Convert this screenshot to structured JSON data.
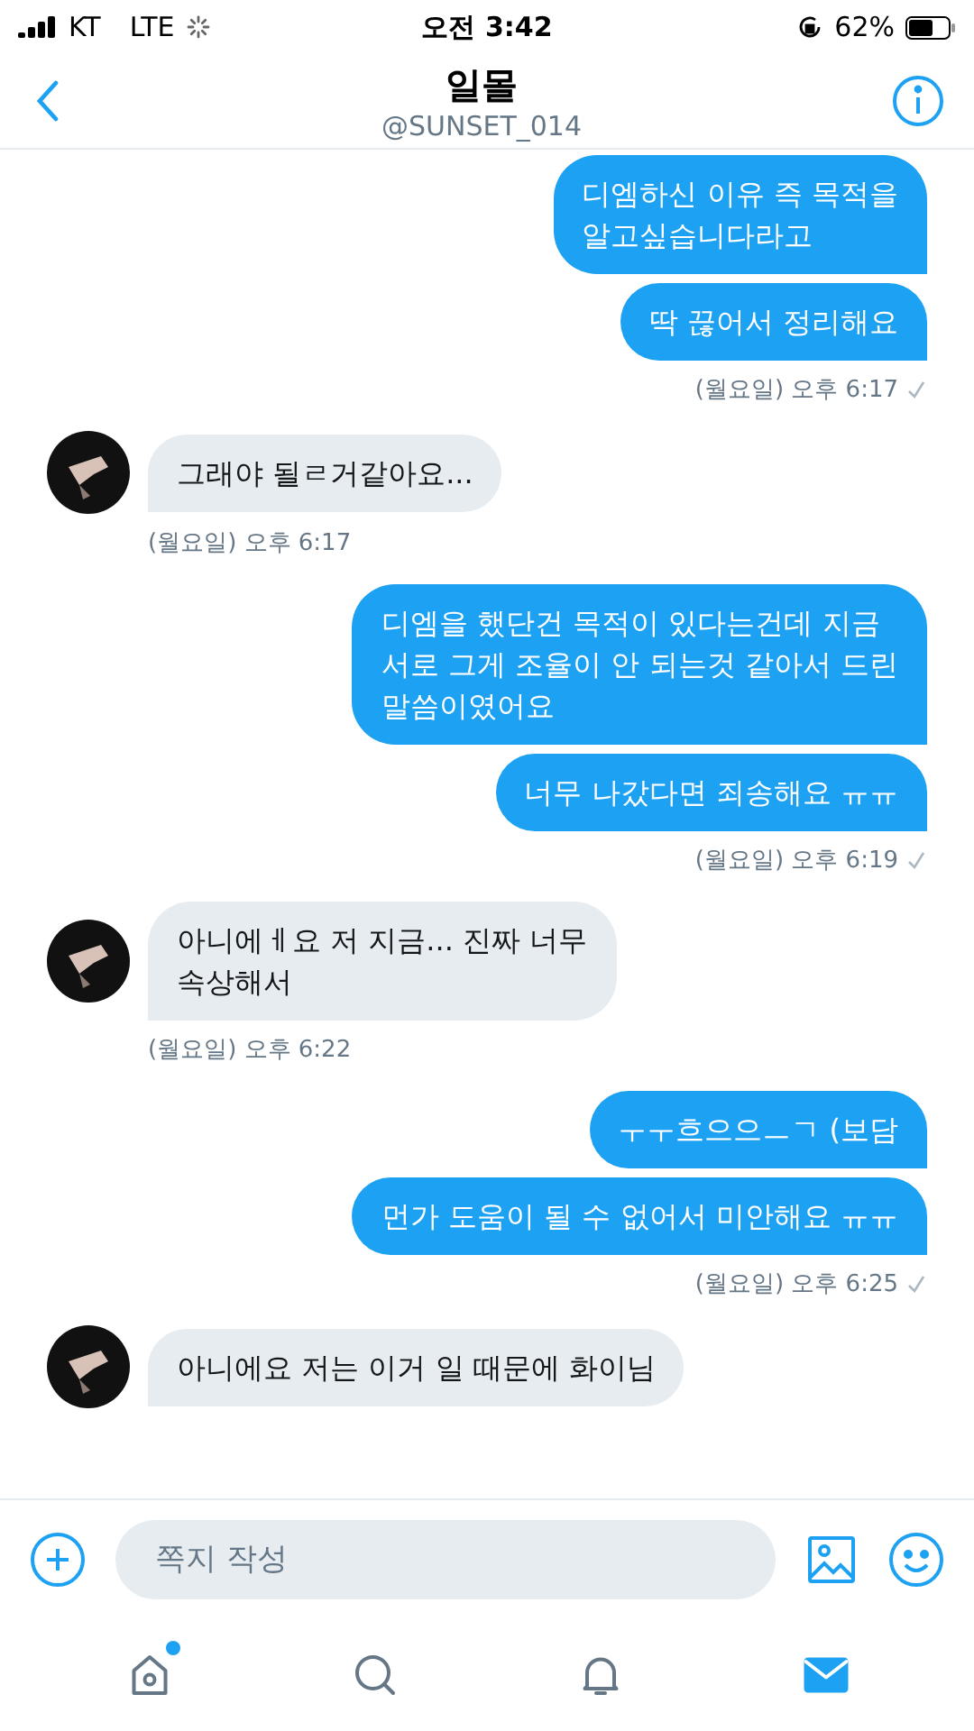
{
  "status_bar": {
    "carrier": "KT",
    "network": "LTE",
    "time": "오전 3:42",
    "battery": "62%"
  },
  "header": {
    "title": "일몰",
    "handle": "@SUNSET_014"
  },
  "groups": [
    {
      "kind": "sent",
      "messages": [
        "디엠하신 이유 즉 목적을\n알고싶습니다라고",
        "딱 끊어서 정리해요"
      ],
      "timestamp": "(월요일) 오후 6:17"
    },
    {
      "kind": "received",
      "messages": [
        "그래야 될ㄹ거같아요..."
      ],
      "timestamp": "(월요일) 오후 6:17"
    },
    {
      "kind": "sent",
      "messages": [
        "디엠을 했단건 목적이 있다는건데 지금\n서로 그게 조율이 안 되는것 같아서 드린\n말씀이였어요",
        "너무 나갔다면 죄송해요 ㅠㅠ"
      ],
      "timestamp": "(월요일) 오후 6:19"
    },
    {
      "kind": "received",
      "messages": [
        "아니에ㅔ요 저 지금... 진짜 너무\n속상해서"
      ],
      "timestamp": "(월요일) 오후 6:22"
    },
    {
      "kind": "sent",
      "messages": [
        "ㅜㅜ흐으으ㅡㄱ (보담",
        "먼가 도움이 될 수 없어서 미안해요 ㅠㅠ"
      ],
      "timestamp": "(월요일) 오후 6:25"
    },
    {
      "kind": "received",
      "messages": [
        "아니에요 저는 이거 일 때문에 화이님"
      ]
    }
  ],
  "composer": {
    "placeholder": "쪽지 작성"
  },
  "tabs": [
    {
      "kind": "home",
      "selected": false,
      "badge": true
    },
    {
      "kind": "search",
      "selected": false
    },
    {
      "kind": "notifications",
      "selected": false
    },
    {
      "kind": "messages",
      "selected": true
    }
  ]
}
